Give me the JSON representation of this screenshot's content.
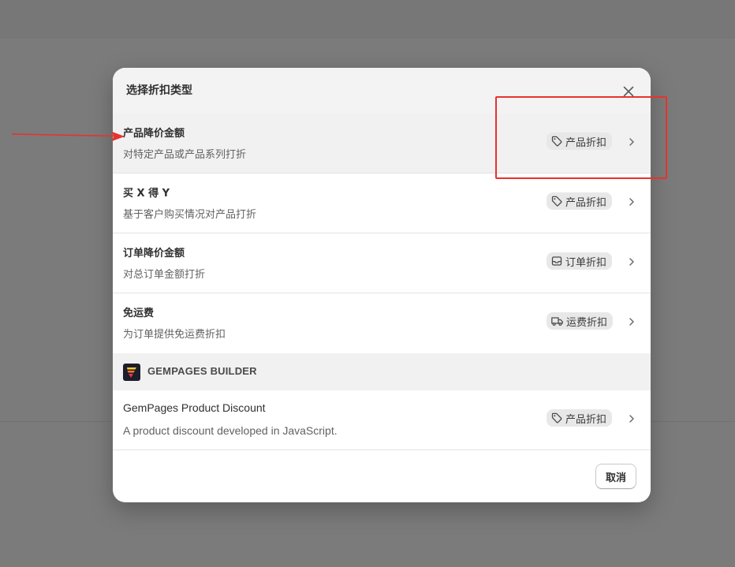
{
  "modal": {
    "title": "选择折扣类型",
    "close_icon": "close-icon"
  },
  "options": [
    {
      "title": "产品降价金额",
      "description": "对特定产品或产品系列打折",
      "badge_label": "产品折扣",
      "badge_icon": "tag-icon",
      "highlighted": true
    },
    {
      "title": "买 X 得 Y",
      "description": "基于客户购买情况对产品打折",
      "badge_label": "产品折扣",
      "badge_icon": "tag-icon"
    },
    {
      "title": "订单降价金额",
      "description": "对总订单金额打折",
      "badge_label": "订单折扣",
      "badge_icon": "order-inbox-icon"
    },
    {
      "title": "免运费",
      "description": "为订单提供免运费折扣",
      "badge_label": "运费折扣",
      "badge_icon": "truck-icon"
    }
  ],
  "app_section": {
    "title": "GEMPAGES BUILDER",
    "logo_icon": "gempages-logo-icon",
    "options": [
      {
        "title": "GemPages Product Discount",
        "description": "A product discount developed in JavaScript.",
        "badge_label": "产品折扣",
        "badge_icon": "tag-icon"
      }
    ]
  },
  "footer": {
    "cancel_label": "取消"
  },
  "colors": {
    "overlay": "#7b7b7b",
    "modal_header": "#f3f3f3",
    "badge_bg": "#e8e8e8",
    "annotation_red": "#e8322c",
    "text_primary": "#303030",
    "text_secondary": "#616161"
  }
}
